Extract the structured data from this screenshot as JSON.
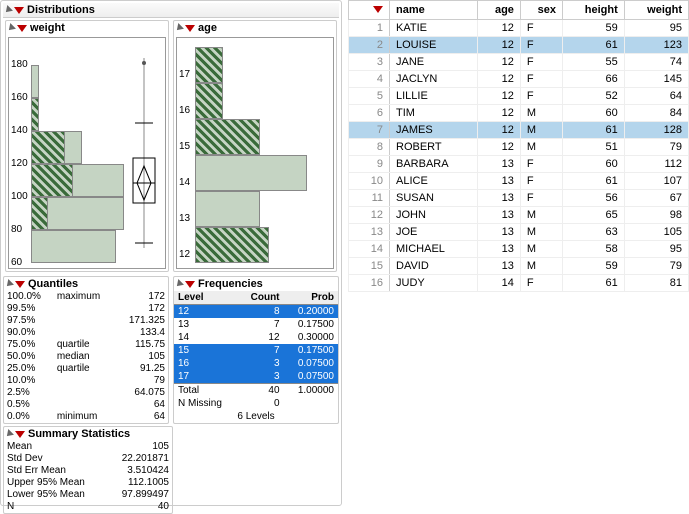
{
  "headers": {
    "distributions": "Distributions",
    "weight": "weight",
    "age": "age",
    "quantiles": "Quantiles",
    "frequencies": "Frequencies",
    "summary": "Summary Statistics"
  },
  "chart_data": [
    {
      "type": "bar",
      "orientation": "horizontal",
      "title": "weight",
      "ylabel": "weight",
      "ylim": [
        60,
        180
      ],
      "bins": [
        {
          "range": "60-80",
          "count": 10,
          "selected": 0
        },
        {
          "range": "80-100",
          "count": 11,
          "selected": 2
        },
        {
          "range": "100-120",
          "count": 11,
          "selected": 5
        },
        {
          "range": "120-140",
          "count": 6,
          "selected": 4
        },
        {
          "range": "140-160",
          "count": 1,
          "selected": 1
        },
        {
          "range": "160-180",
          "count": 1,
          "selected": 0
        }
      ],
      "boxplot": {
        "min": 64,
        "q1": 91.25,
        "median": 105,
        "q3": 115.75,
        "max": 145,
        "outliers": [
          172
        ]
      }
    },
    {
      "type": "bar",
      "orientation": "horizontal",
      "title": "age",
      "ylabel": "age",
      "ylim": [
        12,
        17
      ],
      "bins": [
        {
          "level": 12,
          "count": 8,
          "selected": 8
        },
        {
          "level": 13,
          "count": 7,
          "selected": 0
        },
        {
          "level": 14,
          "count": 12,
          "selected": 0
        },
        {
          "level": 15,
          "count": 7,
          "selected": 7
        },
        {
          "level": 16,
          "count": 3,
          "selected": 3
        },
        {
          "level": 17,
          "count": 3,
          "selected": 3
        }
      ]
    }
  ],
  "quantiles": [
    {
      "pct": "100.0%",
      "label": "maximum",
      "value": "172"
    },
    {
      "pct": "99.5%",
      "label": "",
      "value": "172"
    },
    {
      "pct": "97.5%",
      "label": "",
      "value": "171.325"
    },
    {
      "pct": "90.0%",
      "label": "",
      "value": "133.4"
    },
    {
      "pct": "75.0%",
      "label": "quartile",
      "value": "115.75"
    },
    {
      "pct": "50.0%",
      "label": "median",
      "value": "105"
    },
    {
      "pct": "25.0%",
      "label": "quartile",
      "value": "91.25"
    },
    {
      "pct": "10.0%",
      "label": "",
      "value": "79"
    },
    {
      "pct": "2.5%",
      "label": "",
      "value": "64.075"
    },
    {
      "pct": "0.5%",
      "label": "",
      "value": "64"
    },
    {
      "pct": "0.0%",
      "label": "minimum",
      "value": "64"
    }
  ],
  "frequencies": {
    "headers": [
      "Level",
      "Count",
      "Prob"
    ],
    "rows": [
      {
        "level": "12",
        "count": 8,
        "prob": "0.20000",
        "selected": true
      },
      {
        "level": "13",
        "count": 7,
        "prob": "0.17500",
        "selected": false
      },
      {
        "level": "14",
        "count": 12,
        "prob": "0.30000",
        "selected": false
      },
      {
        "level": "15",
        "count": 7,
        "prob": "0.17500",
        "selected": true
      },
      {
        "level": "16",
        "count": 3,
        "prob": "0.07500",
        "selected": true
      },
      {
        "level": "17",
        "count": 3,
        "prob": "0.07500",
        "selected": true
      }
    ],
    "total_label": "Total",
    "total_count": 40,
    "total_prob": "1.00000",
    "missing_label": "N Missing",
    "missing": 0,
    "levels_label": "6  Levels"
  },
  "summary": [
    {
      "label": "Mean",
      "value": "105"
    },
    {
      "label": "Std Dev",
      "value": "22.201871"
    },
    {
      "label": "Std Err Mean",
      "value": "3.510424"
    },
    {
      "label": "Upper 95% Mean",
      "value": "112.1005"
    },
    {
      "label": "Lower 95% Mean",
      "value": "97.899497"
    },
    {
      "label": "N",
      "value": "40"
    }
  ],
  "table": {
    "headers": [
      "name",
      "age",
      "sex",
      "height",
      "weight"
    ],
    "rows": [
      {
        "n": 1,
        "name": "KATIE",
        "age": 12,
        "sex": "F",
        "height": 59,
        "weight": 95,
        "selected": false
      },
      {
        "n": 2,
        "name": "LOUISE",
        "age": 12,
        "sex": "F",
        "height": 61,
        "weight": 123,
        "selected": true
      },
      {
        "n": 3,
        "name": "JANE",
        "age": 12,
        "sex": "F",
        "height": 55,
        "weight": 74,
        "selected": false
      },
      {
        "n": 4,
        "name": "JACLYN",
        "age": 12,
        "sex": "F",
        "height": 66,
        "weight": 145,
        "selected": false
      },
      {
        "n": 5,
        "name": "LILLIE",
        "age": 12,
        "sex": "F",
        "height": 52,
        "weight": 64,
        "selected": false
      },
      {
        "n": 6,
        "name": "TIM",
        "age": 12,
        "sex": "M",
        "height": 60,
        "weight": 84,
        "selected": false
      },
      {
        "n": 7,
        "name": "JAMES",
        "age": 12,
        "sex": "M",
        "height": 61,
        "weight": 128,
        "selected": true
      },
      {
        "n": 8,
        "name": "ROBERT",
        "age": 12,
        "sex": "M",
        "height": 51,
        "weight": 79,
        "selected": false
      },
      {
        "n": 9,
        "name": "BARBARA",
        "age": 13,
        "sex": "F",
        "height": 60,
        "weight": 112,
        "selected": false
      },
      {
        "n": 10,
        "name": "ALICE",
        "age": 13,
        "sex": "F",
        "height": 61,
        "weight": 107,
        "selected": false
      },
      {
        "n": 11,
        "name": "SUSAN",
        "age": 13,
        "sex": "F",
        "height": 56,
        "weight": 67,
        "selected": false
      },
      {
        "n": 12,
        "name": "JOHN",
        "age": 13,
        "sex": "M",
        "height": 65,
        "weight": 98,
        "selected": false
      },
      {
        "n": 13,
        "name": "JOE",
        "age": 13,
        "sex": "M",
        "height": 63,
        "weight": 105,
        "selected": false
      },
      {
        "n": 14,
        "name": "MICHAEL",
        "age": 13,
        "sex": "M",
        "height": 58,
        "weight": 95,
        "selected": false
      },
      {
        "n": 15,
        "name": "DAVID",
        "age": 13,
        "sex": "M",
        "height": 59,
        "weight": 79,
        "selected": false
      },
      {
        "n": 16,
        "name": "JUDY",
        "age": 14,
        "sex": "F",
        "height": 61,
        "weight": 81,
        "selected": false
      }
    ]
  }
}
